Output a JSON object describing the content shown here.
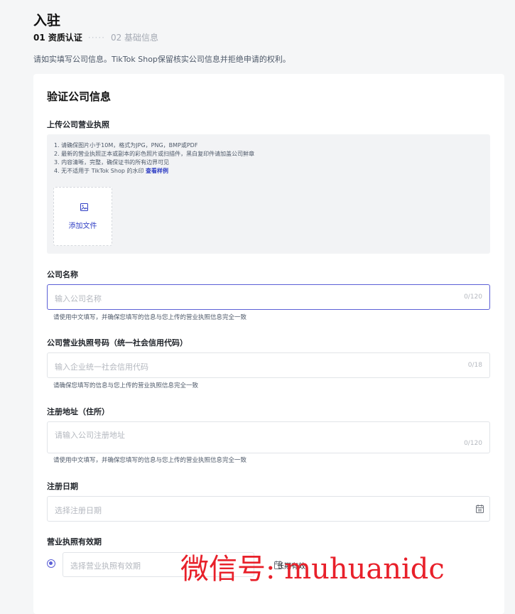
{
  "page": {
    "title": "入驻",
    "steps": {
      "step1": "01 资质认证",
      "dots": "·····",
      "step2": "02 基础信息"
    },
    "intro": "请如实填写公司信息。TikTok Shop保留核实公司信息并拒绝申请的权利。"
  },
  "form": {
    "title": "验证公司信息",
    "license": {
      "label": "上传公司营业执照",
      "tips": [
        "1. 请确保图片小于10M，格式为JPG，PNG，BMP或PDF",
        "2. 最新的营业执照正本或副本的彩色照片或扫描件，黑白复印件请加盖公司鲜章",
        "3. 内容清晰，完整，确保证书的所有边界可见",
        "4. 无不适用于 TikTok Shop 的水印"
      ],
      "tip_link": "查看样例",
      "add_file": "添加文件",
      "add_file_icon": "image-icon"
    },
    "company_name": {
      "label": "公司名称",
      "placeholder": "输入公司名称",
      "count": "0/120",
      "hint": "请使用中文填写，并确保您填写的信息与您上传的营业执照信息完全一致"
    },
    "license_number": {
      "label": "公司营业执照号码（统一社会信用代码）",
      "placeholder": "输入企业统一社会信用代码",
      "count": "0/18",
      "hint": "请确保您填写的信息与您上传的营业执照信息完全一致"
    },
    "address": {
      "label": "注册地址（住所）",
      "placeholder": "请输入公司注册地址",
      "count": "0/120",
      "hint": "请使用中文填写，并确保您填写的信息与您上传的营业执照信息完全一致"
    },
    "reg_date": {
      "label": "注册日期",
      "placeholder": "选择注册日期",
      "icon": "calendar-icon"
    },
    "expiry": {
      "label": "营业执照有效期",
      "placeholder": "选择营业执照有效期",
      "icon": "calendar-icon",
      "long_term": "长期有效"
    }
  },
  "watermark": "微信号: muhuanidc",
  "colors": {
    "accent": "#5b5fd6",
    "link": "#2f3ec4",
    "watermark": "#e8202a"
  }
}
